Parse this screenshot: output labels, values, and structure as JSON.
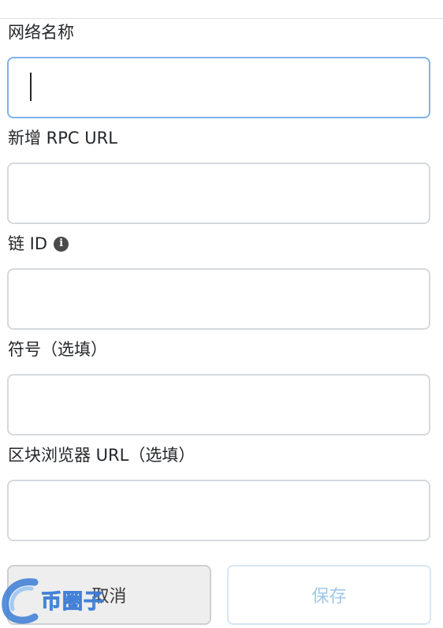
{
  "form": {
    "network_name": {
      "label": "网络名称",
      "value": ""
    },
    "rpc_url": {
      "label": "新增 RPC URL",
      "value": ""
    },
    "chain_id": {
      "label": "链 ID",
      "info_icon": "info-icon",
      "value": ""
    },
    "symbol": {
      "label": "符号（选填）",
      "value": ""
    },
    "explorer_url": {
      "label": "区块浏览器 URL（选填）",
      "value": ""
    }
  },
  "actions": {
    "cancel_label": "取消",
    "save_label": "保存"
  },
  "watermark": {
    "text": "币圈子",
    "icon": "c-swoosh-logo"
  },
  "colors": {
    "focus_border": "#7fb3e6",
    "input_border": "#d6d9dc",
    "save_disabled_text": "#9fc7ec",
    "cancel_bg": "#eeeeee"
  }
}
